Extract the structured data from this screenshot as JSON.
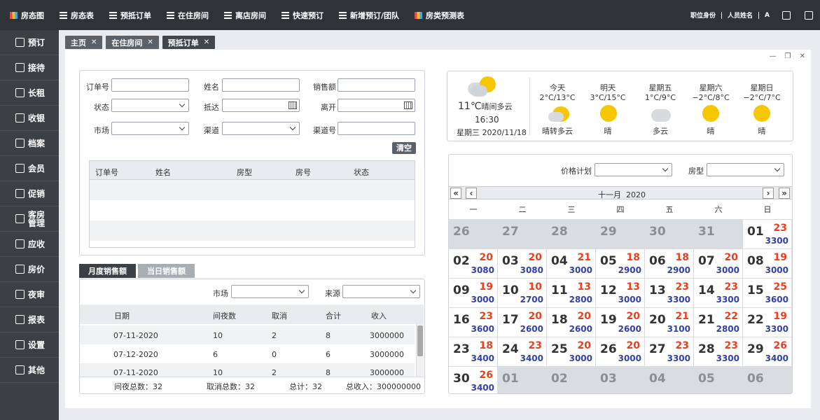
{
  "topnav": [
    "房态图",
    "房态表",
    "预抵订单",
    "在住房间",
    "离店房间",
    "快速预订",
    "新增预订/团队",
    "房类预测表"
  ],
  "topright": {
    "role": "职位身份",
    "user": "人员姓名"
  },
  "sidebar": [
    "预订",
    "接待",
    "长租",
    "收银",
    "档案",
    "会员",
    "促销",
    "客房管理",
    "应收",
    "房价",
    "夜审",
    "报表",
    "设置",
    "其他"
  ],
  "tabs": [
    {
      "label": "主页"
    },
    {
      "label": "在住房间"
    },
    {
      "label": "预抵订单"
    }
  ],
  "search": {
    "order_no": "订单号",
    "name": "姓名",
    "sales": "销售额",
    "status": "状态",
    "arrive": "抵达",
    "depart": "离开",
    "market": "市场",
    "channel": "渠道",
    "channel_no": "渠道号",
    "clear": "清空"
  },
  "order_table": {
    "columns": [
      "订单号",
      "姓名",
      "房型",
      "房号",
      "状态"
    ]
  },
  "sales": {
    "tabs": [
      "月度销售额",
      "当日销售额"
    ],
    "market": "市场",
    "source": "来源",
    "columns": [
      "日期",
      "间夜数",
      "取消",
      "合计",
      "收入"
    ],
    "rows": [
      [
        "07-11-2020",
        "10",
        "2",
        "8",
        "3000000"
      ],
      [
        "07-12-2020",
        "6",
        "0",
        "6",
        "3000000"
      ],
      [
        "07-11-2020",
        "10",
        "2",
        "8",
        "3000000"
      ]
    ],
    "footer": {
      "nights": "间夜总数：32",
      "cancel": "取消总数：32",
      "total": "总计：32",
      "income": "总收入：300000000"
    }
  },
  "weather": {
    "temp": "11℃",
    "desc": "晴间多云",
    "time": "16:30",
    "date": "星期三 2020/11/18",
    "days": [
      {
        "name": "今天",
        "range": "2°C/13°C",
        "cond": "晴转多云",
        "icon": "sun-cloud-icon"
      },
      {
        "name": "明天",
        "range": "3°C/15°C",
        "cond": "晴",
        "icon": "sun-icon"
      },
      {
        "name": "星期五",
        "range": "1°C/9°C",
        "cond": "多云",
        "icon": "cloud-icon"
      },
      {
        "name": "星期六",
        "range": "−2°C/8°C",
        "cond": "晴",
        "icon": "sun-icon"
      },
      {
        "name": "星期日",
        "range": "−2°C/7°C",
        "cond": "晴",
        "icon": "sun-icon"
      }
    ]
  },
  "calendar": {
    "price_plan": "价格计划",
    "room_type": "房型",
    "month": "十一月  2020",
    "weekdays": [
      "一",
      "二",
      "三",
      "四",
      "五",
      "六",
      "日"
    ],
    "colors": {
      "count": "#e8401c",
      "price": "#3340a5"
    },
    "cells": [
      {
        "d": "26",
        "o": true
      },
      {
        "d": "27",
        "o": true
      },
      {
        "d": "28",
        "o": true
      },
      {
        "d": "29",
        "o": true
      },
      {
        "d": "30",
        "o": true
      },
      {
        "d": "31",
        "o": true
      },
      {
        "d": "01",
        "n": "23",
        "p": "3300"
      },
      {
        "d": "02",
        "n": "20",
        "p": "3080"
      },
      {
        "d": "03",
        "n": "20",
        "p": "3080"
      },
      {
        "d": "04",
        "n": "21",
        "p": "3000"
      },
      {
        "d": "05",
        "n": "18",
        "p": "2900"
      },
      {
        "d": "06",
        "n": "18",
        "p": "2900"
      },
      {
        "d": "07",
        "n": "20",
        "p": "3000"
      },
      {
        "d": "08",
        "n": "19",
        "p": "3000"
      },
      {
        "d": "09",
        "n": "19",
        "p": "3000"
      },
      {
        "d": "10",
        "n": "10",
        "p": "2700"
      },
      {
        "d": "11",
        "n": "13",
        "p": "2800"
      },
      {
        "d": "12",
        "n": "13",
        "p": "3000"
      },
      {
        "d": "13",
        "n": "23",
        "p": "3300"
      },
      {
        "d": "14",
        "n": "23",
        "p": "3300"
      },
      {
        "d": "15",
        "n": "25",
        "p": "3600"
      },
      {
        "d": "16",
        "n": "23",
        "p": "3600"
      },
      {
        "d": "17",
        "n": "20",
        "p": "2600"
      },
      {
        "d": "18",
        "n": "20",
        "p": "2600"
      },
      {
        "d": "19",
        "n": "20",
        "p": "2600"
      },
      {
        "d": "20",
        "n": "21",
        "p": "3100"
      },
      {
        "d": "21",
        "n": "22",
        "p": "2800"
      },
      {
        "d": "22",
        "n": "19",
        "p": "3300"
      },
      {
        "d": "23",
        "n": "18",
        "p": "3400"
      },
      {
        "d": "24",
        "n": "23",
        "p": "3400"
      },
      {
        "d": "25",
        "n": "20",
        "p": "3000"
      },
      {
        "d": "26",
        "n": "20",
        "p": "3000"
      },
      {
        "d": "27",
        "n": "23",
        "p": "3300"
      },
      {
        "d": "28",
        "n": "23",
        "p": "3300"
      },
      {
        "d": "29",
        "n": "26",
        "p": "3400"
      },
      {
        "d": "30",
        "n": "26",
        "p": "3400"
      },
      {
        "d": "01",
        "o": true
      },
      {
        "d": "02",
        "o": true
      },
      {
        "d": "03",
        "o": true
      },
      {
        "d": "04",
        "o": true
      },
      {
        "d": "05",
        "o": true
      },
      {
        "d": "06",
        "o": true
      }
    ]
  }
}
